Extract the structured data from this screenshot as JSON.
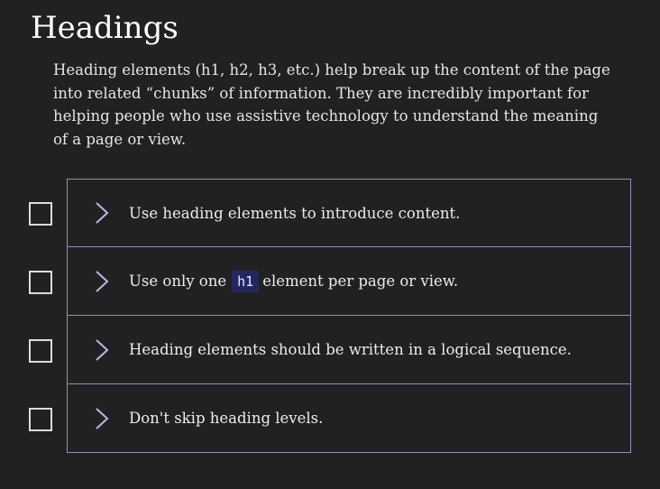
{
  "title": "Headings",
  "intro": "Heading elements (h1, h2, h3, etc.) help break up the content of the page into related “chunks” of information. They are incredibly important for helping people who use assistive technology to understand the meaning of a page or view.",
  "checklist": {
    "items": [
      {
        "label": "Use heading elements to introduce content."
      },
      {
        "label_before": "Use only one",
        "code": "h1",
        "label_after": "element per page or view."
      },
      {
        "label": "Heading elements should be written in a logical sequence."
      },
      {
        "label": "Don't skip heading levels."
      }
    ]
  },
  "colors": {
    "background": "#212121",
    "border": "#8f8fbf",
    "code_background": "#23275f",
    "chevron": "#b7b7ee"
  },
  "icons": {
    "expand": "chevron-right-icon",
    "checkbox": "checkbox-unchecked-icon"
  }
}
